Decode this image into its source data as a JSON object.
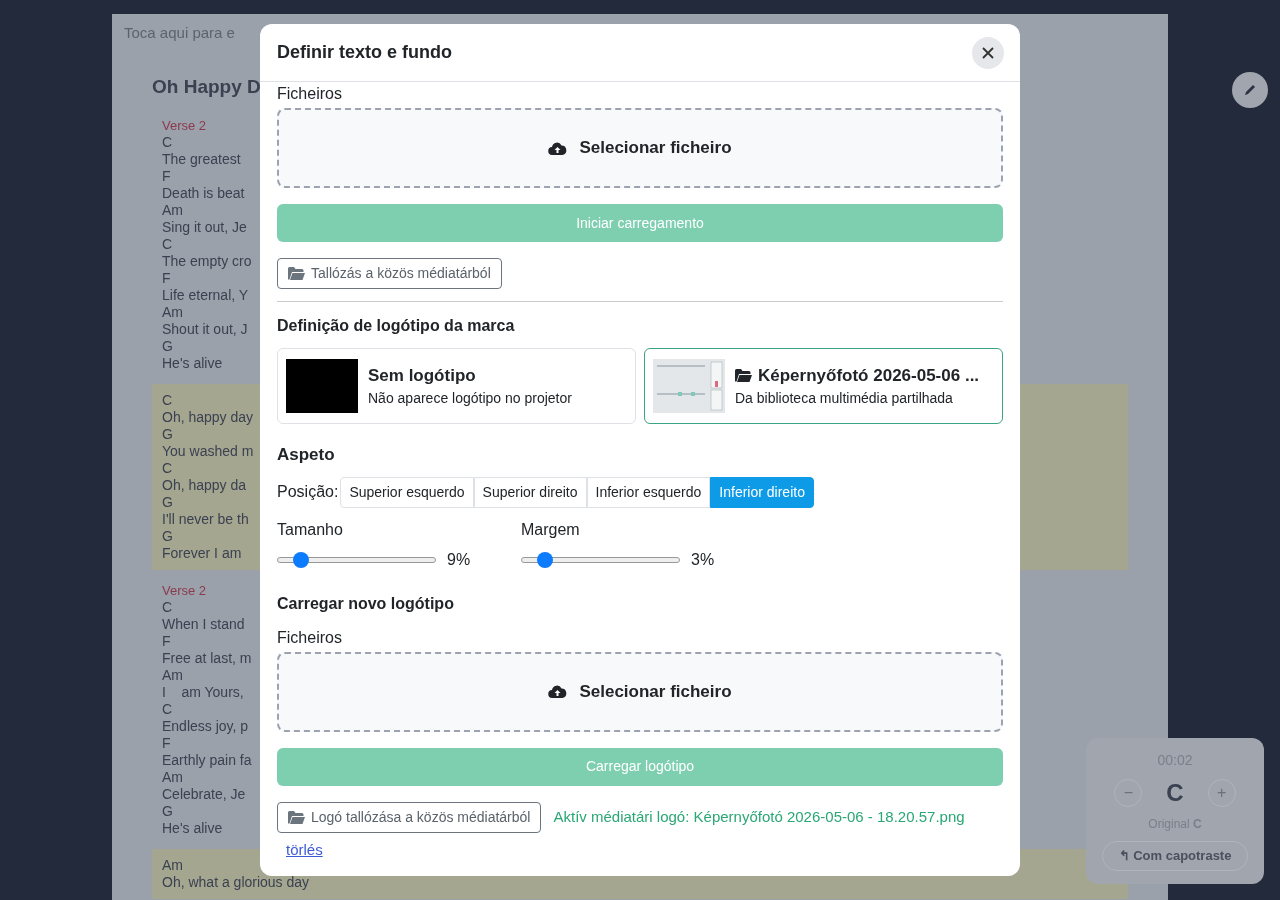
{
  "background": {
    "hint": "Toca aqui para e",
    "song_title": "Oh Happy D",
    "blocks": [
      {
        "kind": "verse",
        "label": "Verse 2",
        "lines": [
          "C",
          "The greatest",
          "F",
          "Death is beat",
          "Am",
          "Sing it out, Je",
          "C",
          "The empty cro",
          "F",
          "Life eternal, Y",
          "Am",
          "Shout it out, J",
          "G",
          "He's alive"
        ]
      },
      {
        "kind": "chorus",
        "lines": [
          "C",
          "Oh, happy day",
          "G",
          "You washed m",
          "C",
          "Oh, happy da",
          "G",
          "I'll never be th",
          "G",
          "Forever I am"
        ]
      },
      {
        "kind": "verse",
        "label": "Verse 2",
        "lines": [
          "C",
          "When I stand",
          "F",
          "Free at last, m",
          "Am",
          "I    am Yours,",
          "C",
          "Endless joy, p",
          "F",
          "Earthly pain fa",
          "Am",
          "Celebrate, Je",
          "G",
          "He's alive"
        ]
      },
      {
        "kind": "chorus",
        "lines": [
          "Am",
          "Oh, what a glorious day"
        ]
      }
    ],
    "player": {
      "time": "00:02",
      "minus": "−",
      "key": "C",
      "plus": "+",
      "original": "Original **C**",
      "capo_button": "↰ Com capotraste"
    }
  },
  "dialog": {
    "title": "Definir texto e fundo",
    "upload": {
      "label": "Ficheiros",
      "dropzone": "Selecionar ficheiro",
      "submit": "Iniciar carregamento",
      "browse": "Tallózás a közös médiatárból"
    },
    "logo_heading": "Definição de logótipo da marca",
    "logo_options": [
      {
        "kind": "none",
        "title": "Sem logótipo",
        "subtitle": "Não aparece logótipo no projetor",
        "selected": false
      },
      {
        "kind": "library",
        "title": "Képernyőfotó 2026-05-06 ...",
        "subtitle": "Da biblioteca multimédia partilhada",
        "selected": true
      }
    ],
    "appearance_heading": "Aspeto",
    "position_label": "Posição:",
    "positions": [
      {
        "label": "Superior esquerdo",
        "selected": false
      },
      {
        "label": "Superior direito",
        "selected": false
      },
      {
        "label": "Inferior esquerdo",
        "selected": false
      },
      {
        "label": "Inferior direito",
        "selected": true
      }
    ],
    "sliders": [
      {
        "label": "Tamanho",
        "level": 0.15,
        "reading": "9%"
      },
      {
        "label": "Margem",
        "level": 0.15,
        "reading": "3%"
      }
    ],
    "new_logo_heading": "Carregar novo logótipo",
    "new_logo": {
      "label": "Ficheiros",
      "dropzone": "Selecionar ficheiro",
      "submit": "Carregar logótipo",
      "browse": "Logó tallózása a közös médiatárból"
    },
    "active_logo": "Aktív médiatári logó: Képernyőfotó 2026-05-06 - 18.20.57.png",
    "delete_link": "törlés"
  }
}
